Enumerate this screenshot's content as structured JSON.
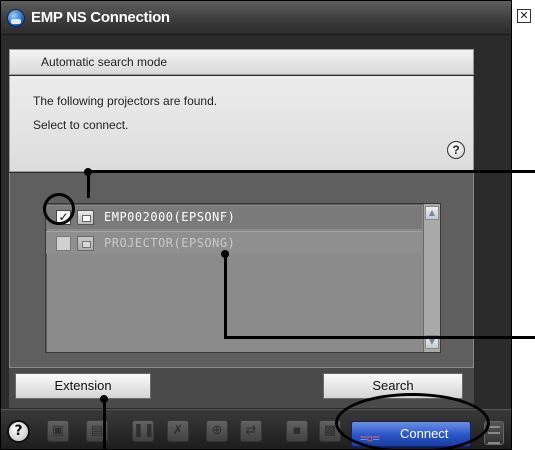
{
  "window": {
    "title": "EMP NS Connection"
  },
  "mode": {
    "label": "Automatic search mode"
  },
  "info": {
    "line1": "The following projectors are found.",
    "line2": "Select to connect.",
    "help": "?"
  },
  "projectors": [
    {
      "name": "EMP002000(EPSONF)",
      "checked": true,
      "check_mark": "✓"
    },
    {
      "name": "PROJECTOR(EPSONG)",
      "checked": false,
      "check_mark": ""
    }
  ],
  "buttons": {
    "extension": "Extension",
    "search": "Search",
    "connect": "Connect",
    "help": "?"
  },
  "colors": {
    "connect_accent": "#2a55c9",
    "window_dark": "#2b2b2b",
    "selected_row": "#7a7a7a"
  },
  "icons": {
    "app": "projector-network-icon",
    "close": "close-icon",
    "toolbar": [
      "help-icon",
      "display-icon",
      "document-icon",
      "pause-icon",
      "no-signal-icon",
      "zoom-icon",
      "switch-icon",
      "av-mute-icon",
      "tile-icon",
      "plug-icon",
      "list-icon"
    ]
  }
}
